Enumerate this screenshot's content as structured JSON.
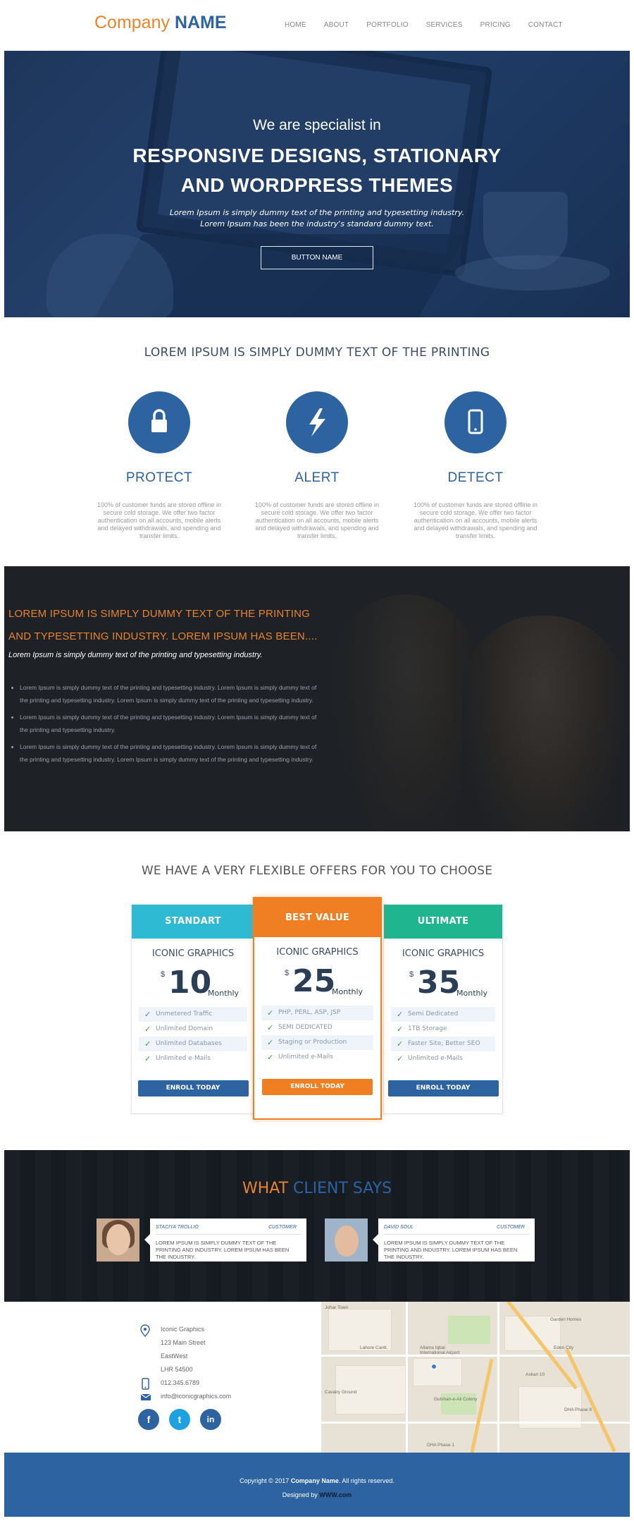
{
  "header": {
    "logo_light": "Company",
    "logo_bold": "NAME",
    "nav": [
      "HOME",
      "ABOUT",
      "PORTFOLIO",
      "SERVICES",
      "PRICING",
      "CONTACT"
    ]
  },
  "hero": {
    "line1": "We are specialist in",
    "line2": "RESPONSIVE DESIGNS, STATIONARY AND WORDPRESS THEMES",
    "sub1": "Lorem Ipsum is simply dummy text of the printing and typesetting industry.",
    "sub2": "Lorem Ipsum has been the industry's standard dummy text.",
    "button": "BUTTON NAME"
  },
  "features": {
    "title": "LOREM IPSUM IS SIMPLY DUMMY TEXT OF THE PRINTING",
    "items": [
      {
        "icon": "lock-icon",
        "name": "PROTECT",
        "desc": "100% of customer funds are stored offline in secure cold storage. We offer two factor authentication on all accounts, mobile alerts and delayed withdrawals, and spending and transfer limits."
      },
      {
        "icon": "lightning-icon",
        "name": "ALERT",
        "desc": "100% of customer funds are stored offline in secure cold storage. We offer two factor authentication on all accounts, mobile alerts and delayed withdrawals, and spending and transfer limits."
      },
      {
        "icon": "mobile-icon",
        "name": "DETECT",
        "desc": "100% of customer funds are stored offline in secure cold storage. We offer two factor authentication on all accounts, mobile alerts and delayed withdrawals, and spending and transfer limits."
      }
    ]
  },
  "team": {
    "heading1": "LOREM IPSUM IS SIMPLY DUMMY TEXT OF THE PRINTING",
    "heading2": "AND TYPESETTING INDUSTRY. LOREM IPSUM HAS BEEN....",
    "sub": "Lorem Ipsum is simply dummy text of the printing and typesetting industry.",
    "bullets": [
      "Lorem Ipsum is simply dummy text of the printing and typesetting industry. Lorem Ipsum is simply dummy text of the printing and typesetting industry. Lorem Ipsum is simply dummy text of the printing and typesetting industry.",
      "Lorem Ipsum is simply dummy text of the printing and typesetting industry. Lorem Ipsum is simply dummy text of the printing and typesetting industry.",
      "Lorem Ipsum is simply dummy text of the printing and typesetting industry. Lorem Ipsum is simply dummy text of the printing and typesetting industry. Lorem Ipsum is simply dummy text of the printing and typesetting industry."
    ]
  },
  "pricing": {
    "title": "WE HAVE A VERY FLEXIBLE OFFERS FOR YOU TO CHOOSE",
    "plans": [
      {
        "label": "STANDART",
        "color": "#2fbad3",
        "name": "ICONIC GRAPHICS",
        "currency": "$",
        "price": "10",
        "period": "Monthly",
        "features": [
          "Unmetered Traffic",
          "Unlimited Domain",
          "Unlimited Databases",
          "Unlimited e-Mails"
        ],
        "button": "ENROLL TODAY",
        "button_color": "#2d63a0"
      },
      {
        "label": "BEST VALUE",
        "color": "#ef7f22",
        "name": "ICONIC GRAPHICS",
        "currency": "$",
        "price": "25",
        "period": "Monthly",
        "features": [
          "PHP, PERL, ASP, JSP",
          "SEMI DEDICATED",
          "Staging or Production",
          "Unlimited e-Mails"
        ],
        "button": "ENROLL TODAY",
        "button_color": "#ef7f22"
      },
      {
        "label": "ULTIMATE",
        "color": "#1fb58f",
        "name": "ICONIC GRAPHICS",
        "currency": "$",
        "price": "35",
        "period": "Monthly",
        "features": [
          "Semi Dedicated",
          "1TB Storage",
          "Faster Site, Better SEO",
          "Unlimited e-Mails"
        ],
        "button": "ENROLL TODAY",
        "button_color": "#2d63a0"
      }
    ]
  },
  "testimonials": {
    "title_a": "WHAT",
    "title_b": "CLIENT SAYS",
    "items": [
      {
        "name": "STACIYA TROLLIO",
        "role": "CUSTOMER",
        "text": "LOREM IPSUM IS SIMPLY DUMMY TEXT OF THE PRINTING AND INDUSTRY. LOREM IPSUM HAS BEEN THE INDUSTRY."
      },
      {
        "name": "DAVID SOUL",
        "role": "CUSTOMER",
        "text": "LOREM IPSUM IS SIMPLY DUMMY TEXT OF THE PRINTING AND INDUSTRY. LOREM IPSUM HAS BEEN THE INDUSTRY."
      }
    ]
  },
  "contact": {
    "company": "Iconic Graphics",
    "street": "123 Main Street",
    "area": "EastWest",
    "postcode": "LHR 54500",
    "phone": "012.345.6789",
    "email": "info@iconicgraphics.com",
    "social": [
      {
        "icon": "facebook-icon",
        "glyph": "f",
        "color": "#2d63a0"
      },
      {
        "icon": "twitter-icon",
        "glyph": "t",
        "color": "#1da1e0"
      },
      {
        "icon": "linkedin-icon",
        "glyph": "in",
        "color": "#2d63a0"
      }
    ],
    "map_labels": [
      "Allama Iqbal International Airport",
      "Lahore Cantt.",
      "Cavalry Ground",
      "Johar Town",
      "DHA Phase 1",
      "Garden Homes",
      "Eden City",
      "Gulshan-e-Ali Colony",
      "Askari 10",
      "DHA Phase 8"
    ]
  },
  "footer": {
    "copy_pre": "Copyright © 2017",
    "copy_name": "Company Name",
    "copy_post": ". All rights reserved.",
    "designed_pre": "Designed by",
    "designed_link": "WWW.com"
  }
}
